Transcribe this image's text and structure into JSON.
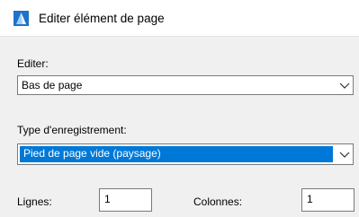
{
  "window": {
    "title": "Editer élément de page",
    "icon": "app-logo-icon"
  },
  "edit": {
    "label": "Editer:",
    "selected": "Bas de page"
  },
  "record_type": {
    "label": "Type d'enregistrement:",
    "selected": "Pied de page vide (paysage)"
  },
  "rows": {
    "label": "Lignes:",
    "value": "1"
  },
  "columns": {
    "label": "Colonnes:",
    "value": "1"
  },
  "colors": {
    "selection": "#0078d7",
    "background": "#f0f0f0"
  }
}
